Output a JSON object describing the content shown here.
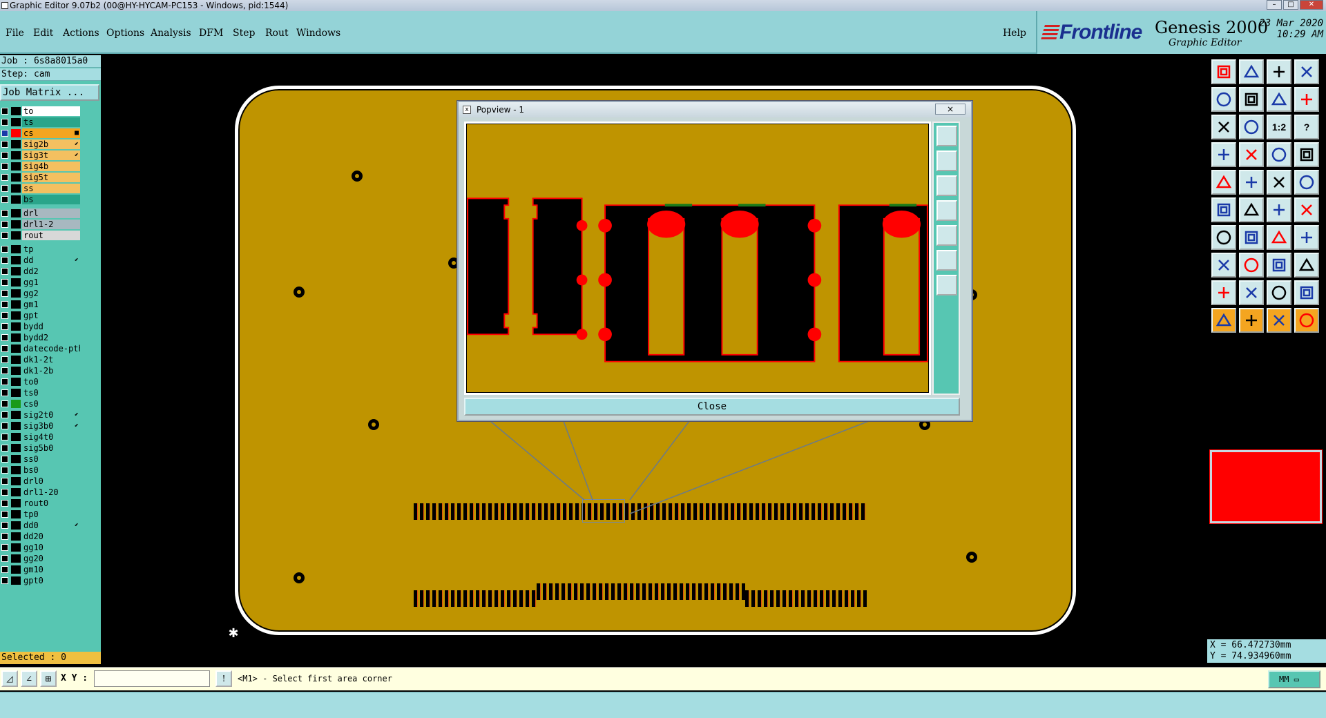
{
  "window": {
    "title": "Graphic Editor 9.07b2 (00@HY-HYCAM-PC153 - Windows, pid:1544)"
  },
  "menu": {
    "items": [
      {
        "label": "File"
      },
      {
        "label": "Edit"
      },
      {
        "label": "Actions"
      },
      {
        "label": "Options"
      },
      {
        "label": "Analysis"
      },
      {
        "label": "DFM"
      },
      {
        "label": "Step"
      },
      {
        "label": "Rout"
      },
      {
        "label": "Windows"
      }
    ],
    "help": "Help"
  },
  "brand": {
    "logo": "Frontline",
    "product": "Genesis 2000",
    "subtitle": "Graphic Editor",
    "date": "23 Mar 2020",
    "time": "10:29 AM"
  },
  "left_panel": {
    "job": "Job : 6s8a8015a0",
    "step": "Step: cam",
    "job_matrix": "Job Matrix ...",
    "selected": "Selected : 0"
  },
  "layers": [
    {
      "name": "to",
      "bg": "#ffffff",
      "sw": "#000000",
      "mark": ""
    },
    {
      "name": "ts",
      "bg": "#2aa58a",
      "sw": "#000000",
      "mark": ""
    },
    {
      "name": "cs",
      "bg": "#f4a520",
      "sw": "#ff0000",
      "mark": "■",
      "checked": true
    },
    {
      "name": "sig2b",
      "bg": "#f4c060",
      "sw": "#000000",
      "mark": "⬋"
    },
    {
      "name": "sig3t",
      "bg": "#f4c060",
      "sw": "#000000",
      "mark": "⬋"
    },
    {
      "name": "sig4b",
      "bg": "#f4c060",
      "sw": "#000000",
      "mark": ""
    },
    {
      "name": "sig5t",
      "bg": "#f4c060",
      "sw": "#000000",
      "mark": ""
    },
    {
      "name": "ss",
      "bg": "#f4c060",
      "sw": "#000000",
      "mark": ""
    },
    {
      "name": "bs",
      "bg": "#2aa58a",
      "sw": "#000000",
      "mark": ""
    },
    {
      "name": "drl",
      "bg": "#a8b8c0",
      "sw": "#000000",
      "mark": ""
    },
    {
      "name": "drl1-2",
      "bg": "#a8b8c0",
      "sw": "#000000",
      "mark": ""
    },
    {
      "name": "rout",
      "bg": "#d8d8d8",
      "sw": "#000000",
      "mark": ""
    },
    {
      "name": "tp",
      "bg": "#57c6b2",
      "sw": "#000000",
      "mark": ""
    },
    {
      "name": "dd",
      "bg": "#57c6b2",
      "sw": "#000000",
      "mark": "⬋"
    },
    {
      "name": "dd2",
      "bg": "#57c6b2",
      "sw": "#000000",
      "mark": ""
    },
    {
      "name": "gg1",
      "bg": "#57c6b2",
      "sw": "#000000",
      "mark": ""
    },
    {
      "name": "gg2",
      "bg": "#57c6b2",
      "sw": "#000000",
      "mark": ""
    },
    {
      "name": "gm1",
      "bg": "#57c6b2",
      "sw": "#000000",
      "mark": ""
    },
    {
      "name": "gpt",
      "bg": "#57c6b2",
      "sw": "#000000",
      "mark": ""
    },
    {
      "name": "bydd",
      "bg": "#57c6b2",
      "sw": "#000000",
      "mark": ""
    },
    {
      "name": "bydd2",
      "bg": "#57c6b2",
      "sw": "#000000",
      "mark": ""
    },
    {
      "name": "datecode-pth",
      "bg": "#57c6b2",
      "sw": "#000000",
      "mark": ""
    },
    {
      "name": "dk1-2t",
      "bg": "#57c6b2",
      "sw": "#000000",
      "mark": ""
    },
    {
      "name": "dk1-2b",
      "bg": "#57c6b2",
      "sw": "#000000",
      "mark": ""
    },
    {
      "name": "to0",
      "bg": "#57c6b2",
      "sw": "#000000",
      "mark": ""
    },
    {
      "name": "ts0",
      "bg": "#57c6b2",
      "sw": "#000000",
      "mark": ""
    },
    {
      "name": "cs0",
      "bg": "#57c6b2",
      "sw": "#1a9a1a",
      "mark": ""
    },
    {
      "name": "sig2t0",
      "bg": "#57c6b2",
      "sw": "#000000",
      "mark": "⬋"
    },
    {
      "name": "sig3b0",
      "bg": "#57c6b2",
      "sw": "#000000",
      "mark": "⬋"
    },
    {
      "name": "sig4t0",
      "bg": "#57c6b2",
      "sw": "#000000",
      "mark": ""
    },
    {
      "name": "sig5b0",
      "bg": "#57c6b2",
      "sw": "#000000",
      "mark": ""
    },
    {
      "name": "ss0",
      "bg": "#57c6b2",
      "sw": "#000000",
      "mark": ""
    },
    {
      "name": "bs0",
      "bg": "#57c6b2",
      "sw": "#000000",
      "mark": ""
    },
    {
      "name": "drl0",
      "bg": "#57c6b2",
      "sw": "#000000",
      "mark": ""
    },
    {
      "name": "drl1-20",
      "bg": "#57c6b2",
      "sw": "#000000",
      "mark": ""
    },
    {
      "name": "rout0",
      "bg": "#57c6b2",
      "sw": "#000000",
      "mark": ""
    },
    {
      "name": "tp0",
      "bg": "#57c6b2",
      "sw": "#000000",
      "mark": ""
    },
    {
      "name": "dd0",
      "bg": "#57c6b2",
      "sw": "#000000",
      "mark": "⬋"
    },
    {
      "name": "dd20",
      "bg": "#57c6b2",
      "sw": "#000000",
      "mark": ""
    },
    {
      "name": "gg10",
      "bg": "#57c6b2",
      "sw": "#000000",
      "mark": ""
    },
    {
      "name": "gg20",
      "bg": "#57c6b2",
      "sw": "#000000",
      "mark": ""
    },
    {
      "name": "gm10",
      "bg": "#57c6b2",
      "sw": "#000000",
      "mark": ""
    },
    {
      "name": "gpt0",
      "bg": "#57c6b2",
      "sw": "#000000",
      "mark": ""
    }
  ],
  "popview": {
    "title": "Popview - 1",
    "close_icon": "×",
    "close_button": "Close"
  },
  "toolbar_right": {
    "scale_label": "1:2",
    "help_label": "?"
  },
  "status": {
    "x": "X = 66.472730mm",
    "y": "Y = 74.934960mm",
    "xy_label": "X Y :",
    "xy_value": "",
    "prompt": "<M1> - Select first area corner",
    "units": "MM"
  },
  "colors": {
    "board": "#bf9400",
    "panel_teal": "#57c6b2",
    "menu_bg": "#94d3d7",
    "highlight_red": "#ff0000"
  }
}
